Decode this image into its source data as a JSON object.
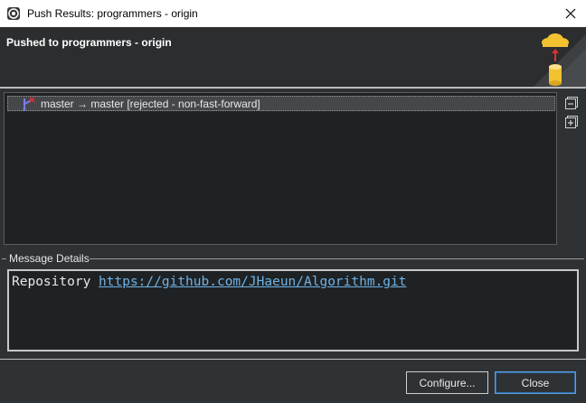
{
  "window": {
    "title": "Push Results: programmers - origin"
  },
  "banner": {
    "heading": "Pushed to programmers - origin"
  },
  "results": {
    "rows": [
      {
        "label": "master → master [rejected - non-fast-forward]"
      }
    ]
  },
  "message_details": {
    "legend": "Message Details",
    "prefix": "Repository ",
    "url": "https://github.com/JHaeun/Algorithm.git"
  },
  "buttons": {
    "configure": "Configure...",
    "close": "Close"
  },
  "colors": {
    "accent": "#5aa0e0",
    "link": "#6fb2e6",
    "dialog_bg": "#2f3234",
    "panel_bg": "#1f2224",
    "error_red": "#e03030"
  },
  "icons": {
    "app": "eclipse-app-icon",
    "close": "close-icon",
    "banner": "push-wizard-cloud-icon",
    "row": "branch-rejected-icon",
    "collapse": "collapse-all-icon",
    "expand": "expand-all-icon"
  }
}
